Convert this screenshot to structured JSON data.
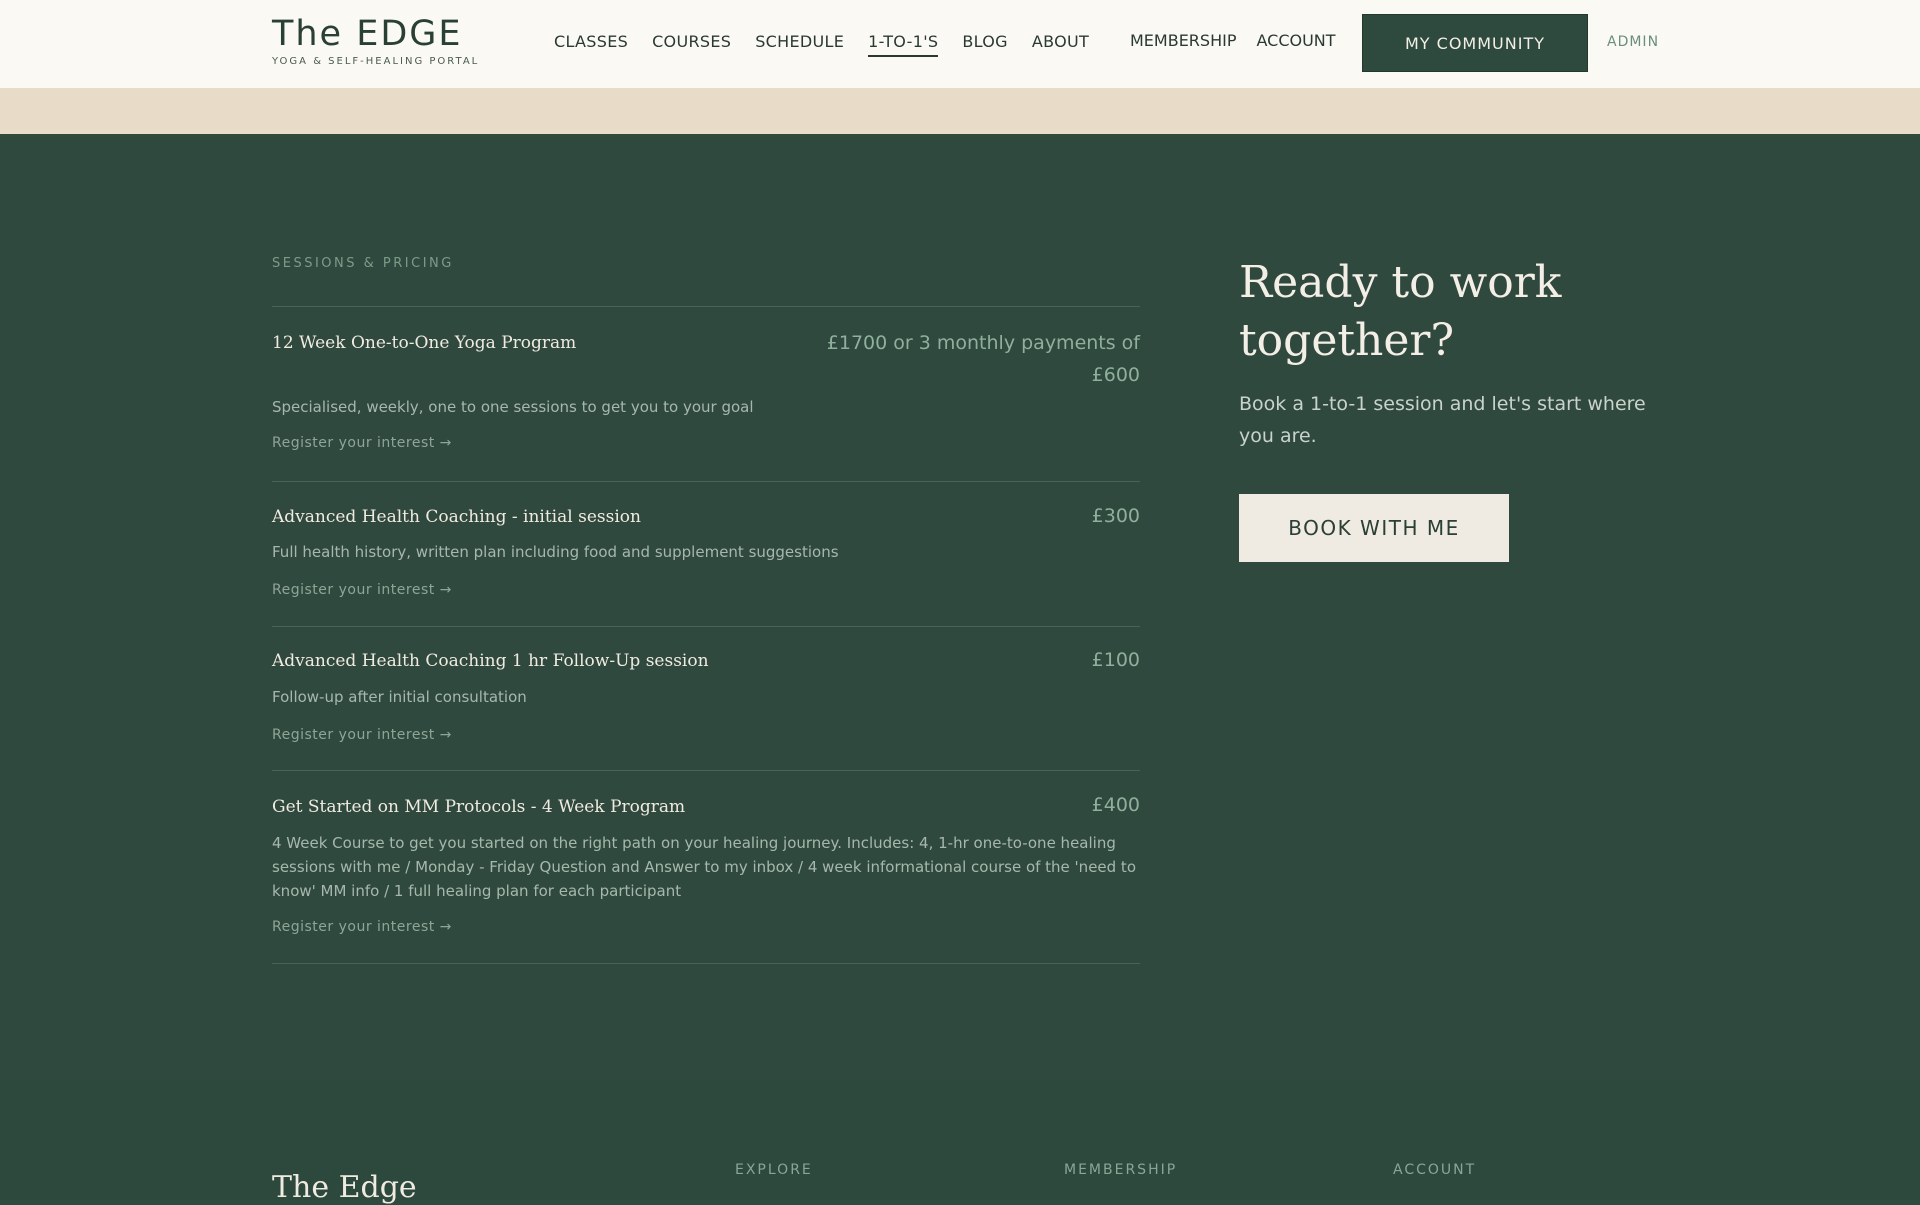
{
  "header": {
    "logo_title": "The EDGE",
    "logo_subtitle": "YOGA & SELF-HEALING PORTAL",
    "nav": [
      "CLASSES",
      "COURSES",
      "SCHEDULE",
      "1-TO-1'S",
      "BLOG",
      "ABOUT"
    ],
    "active_nav": "1-TO-1'S",
    "membership": "MEMBERSHIP",
    "account": "ACCOUNT",
    "community_button": "MY COMMUNITY",
    "admin": "ADMIN"
  },
  "sessions": {
    "section_label": "SESSIONS & PRICING",
    "items": [
      {
        "title": "12 Week One-to-One Yoga Program",
        "price_line1": "£1700 or 3 monthly payments of",
        "price_line2": "£600",
        "description": "Specialised, weekly, one to one sessions to get you to your goal",
        "link": "Register your interest →"
      },
      {
        "title": "Advanced Health Coaching - initial session",
        "price_line1": "£300",
        "description": "Full health history, written plan including food and supplement suggestions",
        "link": "Register your interest →"
      },
      {
        "title": "Advanced Health Coaching 1 hr Follow-Up session",
        "price_line1": "£100",
        "description": "Follow-up after initial consultation",
        "link": "Register your interest →"
      },
      {
        "title": "Get Started on MM Protocols - 4 Week Program",
        "price_line1": "£400",
        "description": "4 Week Course to get you started on the right path on your healing journey. Includes: 4, 1-hr one-to-one healing sessions with me / Monday - Friday Question and Answer to my inbox / 4 week informational course of the 'need to know' MM info / 1 full healing plan for each participant",
        "link": "Register your interest →"
      }
    ]
  },
  "cta": {
    "title": "Ready to work together?",
    "text": "Book a 1-to-1 session and let's start where you are.",
    "button": "BOOK WITH ME"
  },
  "footer": {
    "logo": "The Edge",
    "headings": [
      "EXPLORE",
      "MEMBERSHIP",
      "ACCOUNT"
    ]
  },
  "colors": {
    "header_bg": "#fbf9f4",
    "band": "#e8dcc8",
    "main_bg": "#30493e",
    "accent_green": "#2e4a3f",
    "price_green": "#8fb09c"
  }
}
